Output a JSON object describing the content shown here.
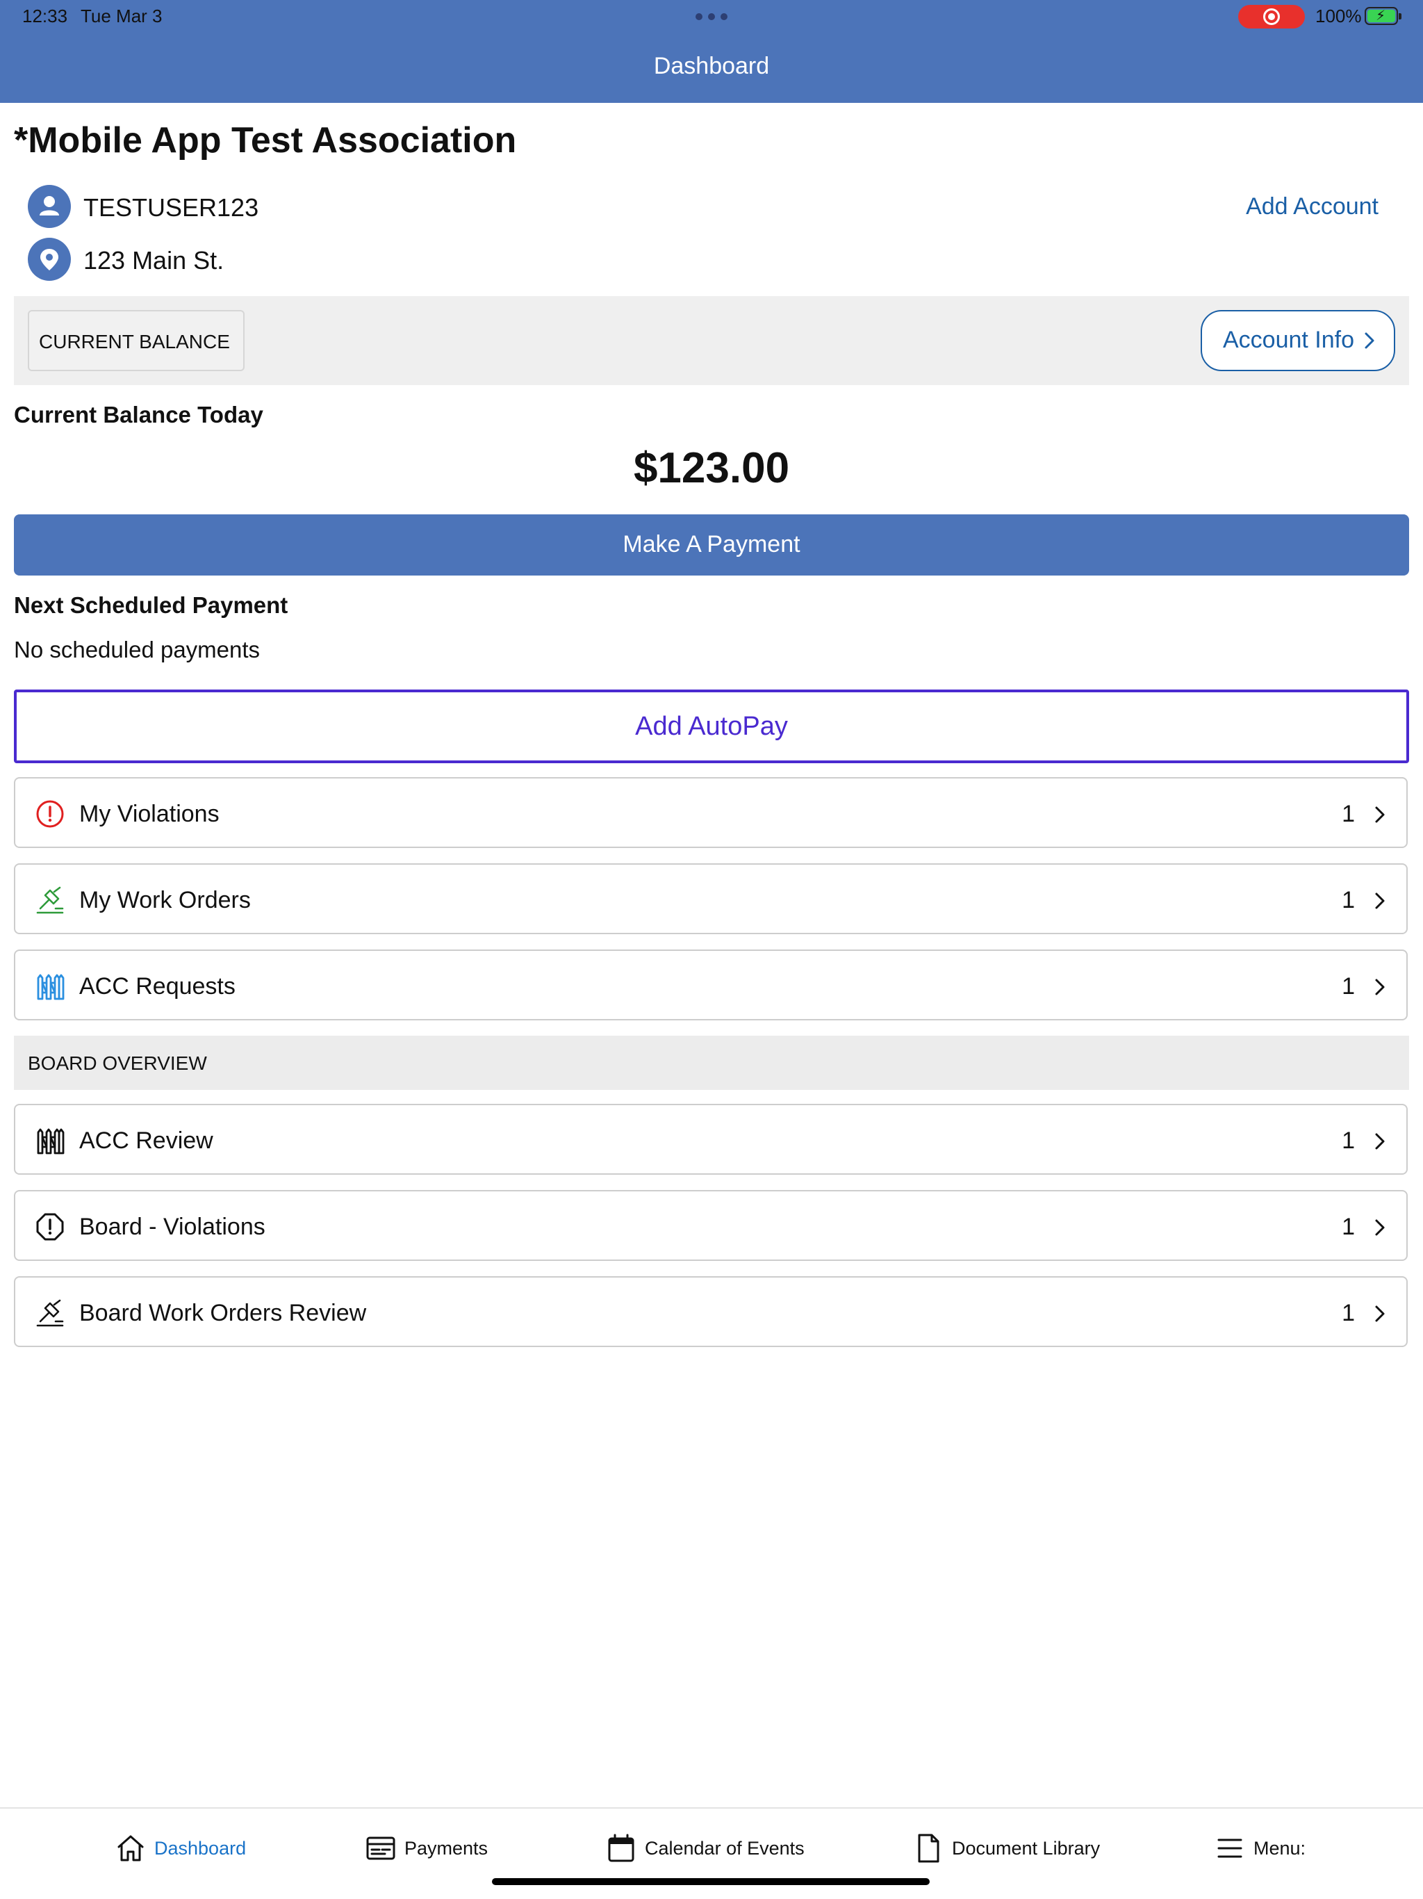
{
  "status_bar": {
    "time": "12:33",
    "date": "Tue Mar 3",
    "battery": "100%"
  },
  "header": {
    "title": "Dashboard"
  },
  "association": {
    "name": "*Mobile App Test Association",
    "username": "TESTUSER123",
    "address": "123 Main St.",
    "add_account_label": "Add Account"
  },
  "balance": {
    "tab_label": "CURRENT BALANCE",
    "account_info_label": "Account Info",
    "today_label": "Current Balance Today",
    "amount": "$123.00",
    "make_payment_label": "Make A Payment"
  },
  "scheduled": {
    "label": "Next Scheduled Payment",
    "text": "No scheduled payments",
    "autopay_label": "Add AutoPay"
  },
  "my_items": [
    {
      "label": "My Violations",
      "count": "1",
      "icon": "alert-circle-icon",
      "icon_color": "#e02020"
    },
    {
      "label": "My Work Orders",
      "count": "1",
      "icon": "hammer-icon",
      "icon_color": "#2e9b3a"
    },
    {
      "label": "ACC Requests",
      "count": "1",
      "icon": "fence-icon",
      "icon_color": "#2a8fe0"
    }
  ],
  "board": {
    "heading": "BOARD OVERVIEW",
    "items": [
      {
        "label": "ACC Review",
        "count": "1",
        "icon": "fence-icon",
        "icon_color": "#111111"
      },
      {
        "label": "Board - Violations",
        "count": "1",
        "icon": "alert-octagon-icon",
        "icon_color": "#111111"
      },
      {
        "label": "Board Work Orders Review",
        "count": "1",
        "icon": "hammer-icon",
        "icon_color": "#111111"
      }
    ]
  },
  "tabbar": {
    "tabs": [
      {
        "label": "Dashboard",
        "icon": "home-icon",
        "active": true
      },
      {
        "label": "Payments",
        "icon": "payments-icon",
        "active": false
      },
      {
        "label": "Calendar of Events",
        "icon": "calendar-icon",
        "active": false
      },
      {
        "label": "Document Library",
        "icon": "document-icon",
        "active": false
      },
      {
        "label": "Menu:",
        "icon": "menu-icon",
        "active": false
      }
    ]
  },
  "colors": {
    "brand": "#4c74b9",
    "link": "#1a5fa6",
    "autopay": "#4a2ad0",
    "active_tab": "#1a73c8"
  }
}
